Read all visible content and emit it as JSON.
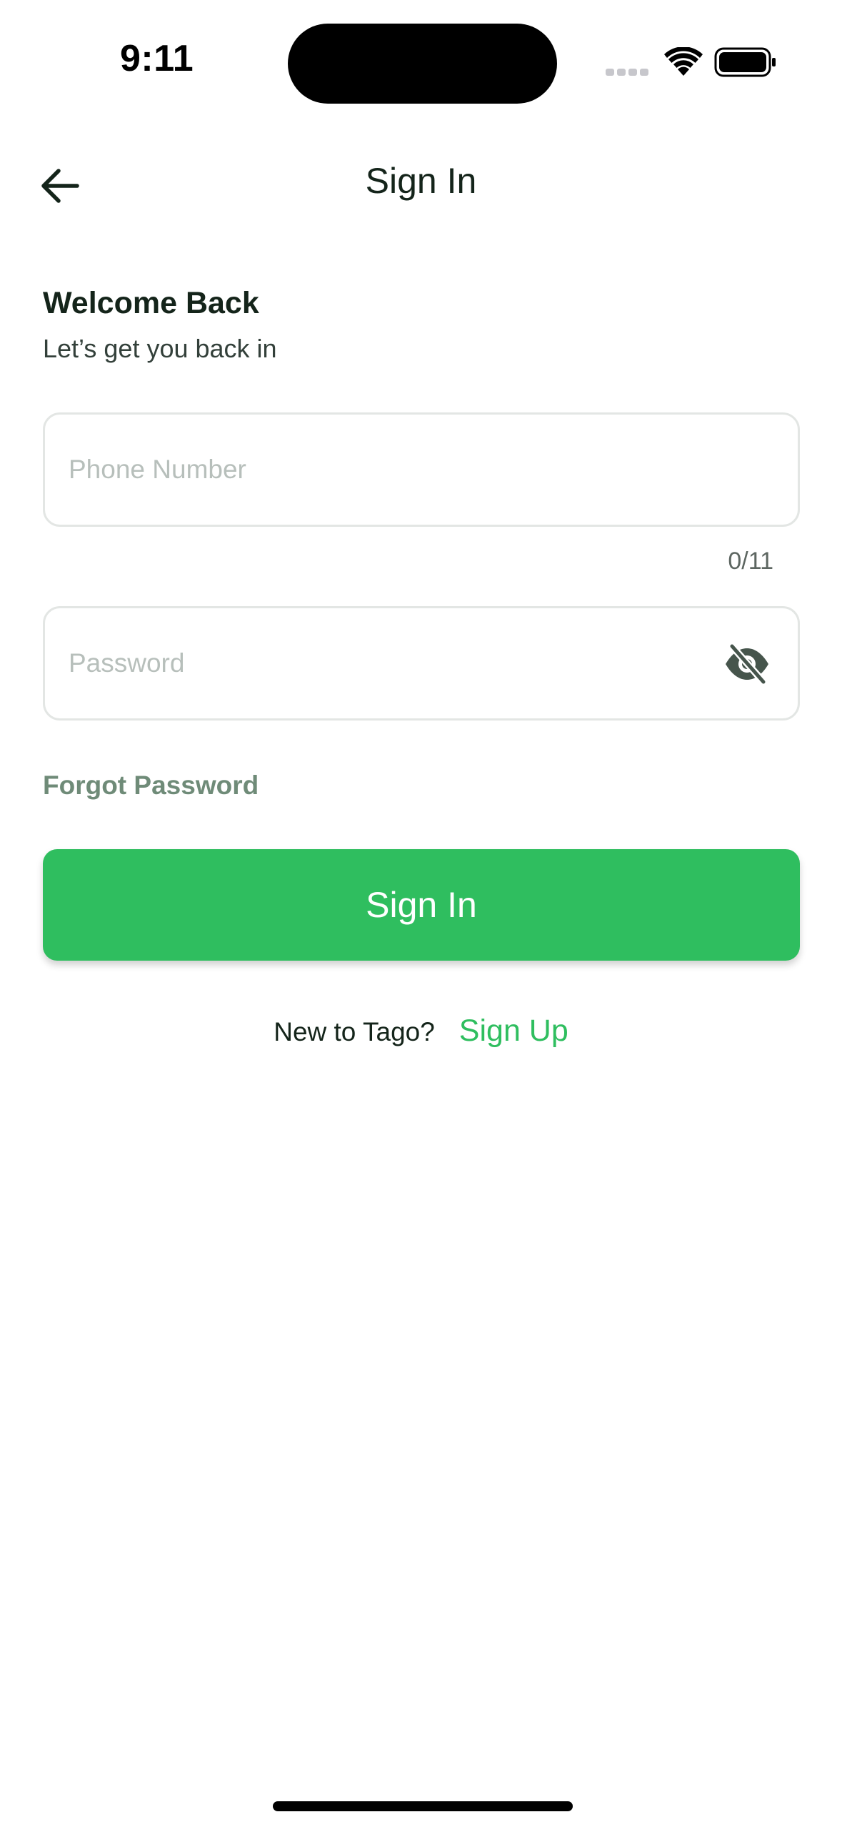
{
  "status_bar": {
    "time": "9:11"
  },
  "header": {
    "title": "Sign In",
    "back_icon": "arrow-left-icon"
  },
  "welcome": {
    "title": "Welcome Back",
    "subtitle": "Let’s get you back in"
  },
  "form": {
    "phone": {
      "value": "",
      "placeholder": "Phone Number",
      "counter": "0/11"
    },
    "password": {
      "value": "",
      "placeholder": "Password",
      "visibility_icon": "eye-off-icon"
    },
    "forgot_label": "Forgot Password",
    "submit_label": "Sign In"
  },
  "signup": {
    "prompt": "New to Tago?",
    "link_label": "Sign Up"
  },
  "colors": {
    "accent": "#2fbe5f",
    "forgot_link": "#6f8b78",
    "text": "#14241a",
    "field_border": "#e3e6e4",
    "placeholder": "#b7bfbb"
  }
}
